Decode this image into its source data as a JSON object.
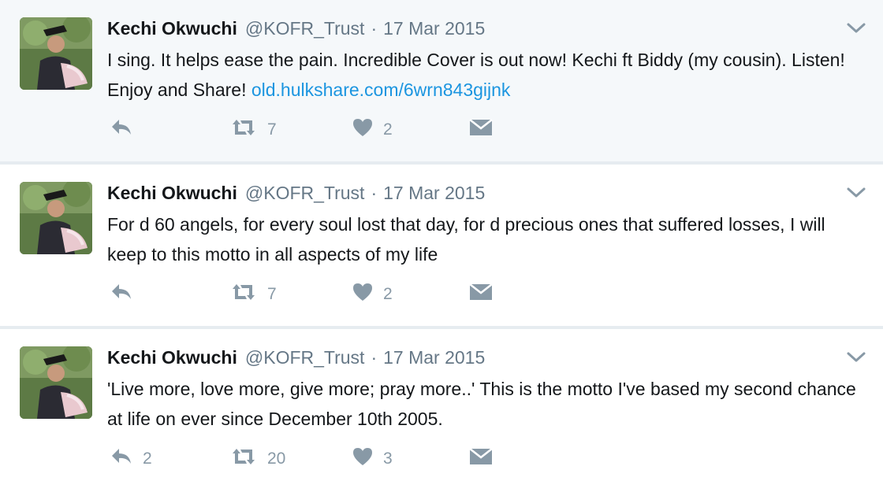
{
  "tweets": [
    {
      "name": "Kechi Okwuchi",
      "handle": "@KOFR_Trust",
      "separator": "·",
      "time": "17 Mar 2015",
      "text": "I sing. It helps ease the pain. Incredible Cover is out now! Kechi ft Biddy (my cousin). Listen! Enjoy and Share! ",
      "link": "old.hulkshare.com/6wrn843gijnk",
      "reply_count": "",
      "retweet_count": "7",
      "like_count": "2"
    },
    {
      "name": "Kechi Okwuchi",
      "handle": "@KOFR_Trust",
      "separator": "·",
      "time": "17 Mar 2015",
      "text": "For d 60 angels, for every soul lost that day, for d precious ones that suffered losses, I will keep to this motto in all aspects of my life",
      "link": "",
      "reply_count": "",
      "retweet_count": "7",
      "like_count": "2"
    },
    {
      "name": "Kechi Okwuchi",
      "handle": "@KOFR_Trust",
      "separator": "·",
      "time": "17 Mar 2015",
      "text": "'Live more, love more, give more; pray more..' This is the motto I've based my second chance at life on ever since December 10th 2005.",
      "link": "",
      "reply_count": "2",
      "retweet_count": "20",
      "like_count": "3"
    }
  ],
  "icons": {
    "reply": "reply-icon",
    "retweet": "retweet-icon",
    "like": "heart-icon",
    "dm": "direct-message-icon",
    "menu": "chevron-down-icon"
  },
  "colors": {
    "text": "#14171a",
    "muted": "#657786",
    "icon": "#8899a6",
    "link": "#1b95e0",
    "highlight_bg": "#f5f8fa",
    "divider": "#e6ecf0"
  }
}
